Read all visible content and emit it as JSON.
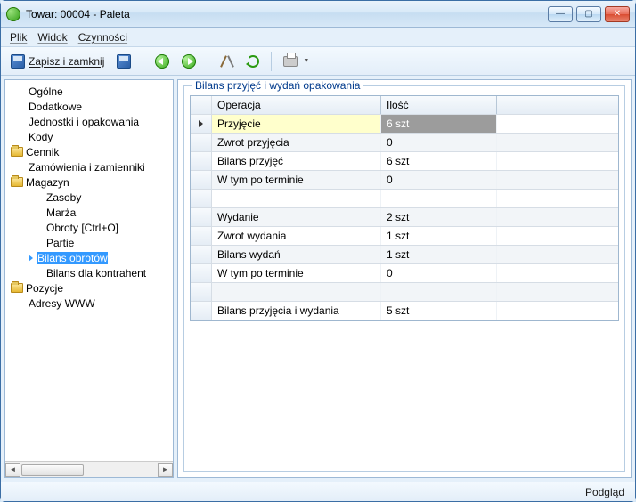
{
  "window": {
    "title": "Towar: 00004 - Paleta"
  },
  "menu": {
    "file": "Plik",
    "view": "Widok",
    "actions": "Czynności"
  },
  "toolbar": {
    "save_close": "Zapisz i zamknij"
  },
  "sidebar": {
    "items": {
      "general": "Ogólne",
      "additional": "Dodatkowe",
      "units": "Jednostki i opakowania",
      "codes": "Kody",
      "pricelist": "Cennik",
      "orders": "Zamówienia i zamienniki",
      "warehouse": "Magazyn",
      "stock": "Zasoby",
      "margin": "Marża",
      "turnover": "Obroty [Ctrl+O]",
      "batches": "Partie",
      "balance": "Bilans obrotów",
      "contr_balance": "Bilans dla kontrahent",
      "positions": "Pozycje",
      "www": "Adresy WWW"
    }
  },
  "panel": {
    "title": "Bilans przyjęć i wydań opakowania",
    "columns": {
      "op": "Operacja",
      "qty": "Ilość"
    },
    "rows": [
      {
        "op": "Przyjęcie",
        "qty": "6 szt",
        "selected": true
      },
      {
        "op": "Zwrot przyjęcia",
        "qty": "0"
      },
      {
        "op": "Bilans przyjęć",
        "qty": "6 szt"
      },
      {
        "op": "W tym po terminie",
        "qty": "0"
      },
      {
        "op": "",
        "qty": "",
        "spacer": true
      },
      {
        "op": "Wydanie",
        "qty": "2 szt"
      },
      {
        "op": "Zwrot wydania",
        "qty": "1 szt"
      },
      {
        "op": "Bilans wydań",
        "qty": "1 szt"
      },
      {
        "op": "W tym po terminie",
        "qty": "0"
      },
      {
        "op": "",
        "qty": "",
        "spacer": true
      },
      {
        "op": "Bilans przyjęcia i wydania",
        "qty": "5 szt"
      }
    ]
  },
  "status": {
    "mode": "Podgląd"
  }
}
